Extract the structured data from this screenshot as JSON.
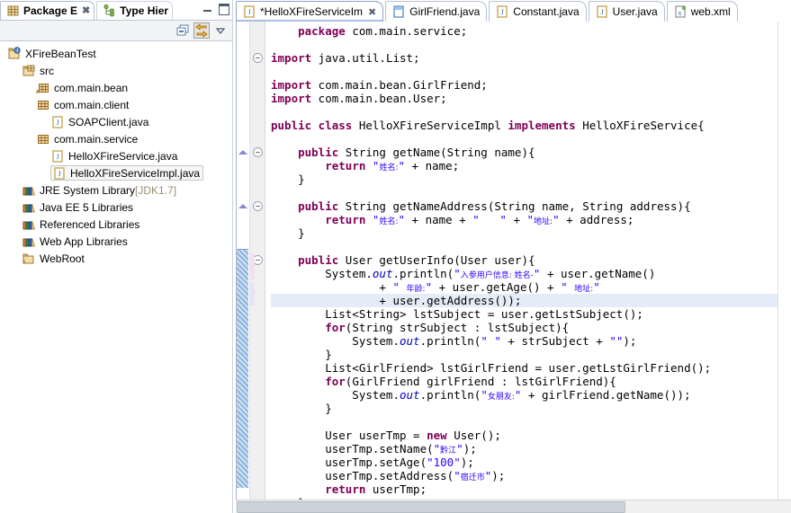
{
  "left_view": {
    "tabs": [
      {
        "label": "Package E",
        "icon": "package-explorer-icon",
        "active": true,
        "closable": true
      },
      {
        "label": "Type Hier",
        "icon": "type-hierarchy-icon",
        "active": false,
        "closable": false
      }
    ],
    "window_controls": [
      {
        "name": "minimize-button",
        "label": "–"
      },
      {
        "name": "maximize-button",
        "label": "□"
      }
    ],
    "toolbar": [
      {
        "name": "collapse-all-button",
        "label": "Collapse All",
        "icon": "collapse-all-icon",
        "pressed": false
      },
      {
        "name": "link-with-editor-button",
        "label": "Link with Editor",
        "icon": "link-editor-icon",
        "pressed": true
      },
      {
        "name": "view-menu-button",
        "label": "View Menu",
        "icon": "chevron-down-icon",
        "pressed": false
      }
    ],
    "tree": [
      {
        "label": "XFireBeanTest",
        "indent": 0,
        "icon": "java-project-icon",
        "selected": false,
        "suffix": ""
      },
      {
        "label": "src",
        "indent": 1,
        "icon": "source-folder-icon",
        "selected": false,
        "suffix": ""
      },
      {
        "label": "com.main.bean",
        "indent": 2,
        "icon": "package-warning-icon",
        "selected": false,
        "suffix": ""
      },
      {
        "label": "com.main.client",
        "indent": 2,
        "icon": "package-icon",
        "selected": false,
        "suffix": ""
      },
      {
        "label": "SOAPClient.java",
        "indent": 3,
        "icon": "java-file-icon",
        "selected": false,
        "suffix": ""
      },
      {
        "label": "com.main.service",
        "indent": 2,
        "icon": "package-icon",
        "selected": false,
        "suffix": ""
      },
      {
        "label": "HelloXFireService.java",
        "indent": 3,
        "icon": "java-file-icon",
        "selected": false,
        "suffix": ""
      },
      {
        "label": "HelloXFireServiceImpl.java",
        "indent": 3,
        "icon": "java-file-icon",
        "selected": true,
        "suffix": ""
      },
      {
        "label": "JRE System Library",
        "indent": 1,
        "icon": "library-icon",
        "selected": false,
        "suffix": " [JDK1.7]"
      },
      {
        "label": "Java EE 5 Libraries",
        "indent": 1,
        "icon": "library-icon",
        "selected": false,
        "suffix": ""
      },
      {
        "label": "Referenced Libraries",
        "indent": 1,
        "icon": "library-icon",
        "selected": false,
        "suffix": ""
      },
      {
        "label": "Web App Libraries",
        "indent": 1,
        "icon": "library-icon",
        "selected": false,
        "suffix": ""
      },
      {
        "label": "WebRoot",
        "indent": 1,
        "icon": "folder-icon",
        "selected": false,
        "suffix": ""
      }
    ]
  },
  "editor": {
    "tabs": [
      {
        "label": "*HelloXFireServiceIm",
        "icon": "java-file-icon",
        "active": true,
        "closable": true,
        "dirty": true
      },
      {
        "label": "GirlFriend.java",
        "icon": "java-class-icon",
        "active": false,
        "closable": false,
        "dirty": false
      },
      {
        "label": "Constant.java",
        "icon": "java-file-icon",
        "active": false,
        "closable": false,
        "dirty": false
      },
      {
        "label": "User.java",
        "icon": "java-file-icon",
        "active": false,
        "closable": false,
        "dirty": false
      },
      {
        "label": "web.xml",
        "icon": "xml-file-icon",
        "active": false,
        "closable": false,
        "dirty": false
      }
    ],
    "colors": {
      "keyword": "#7f0055",
      "string": "#2a00ff",
      "field": "#0000c0",
      "plain": "#000000",
      "highlight_line": "#e4ecf7",
      "active_tab_bar": "#a8c0de"
    },
    "code_lines": [
      {
        "highlight": false,
        "fold": false,
        "annot": false,
        "tokens": [
          {
            "t": "    ",
            "c": "pln"
          },
          {
            "t": "package",
            "c": "kw"
          },
          {
            "t": " com.main.service;",
            "c": "pln"
          }
        ]
      },
      {
        "highlight": false,
        "fold": false,
        "annot": false,
        "tokens": []
      },
      {
        "highlight": false,
        "fold": true,
        "annot": false,
        "tokens": [
          {
            "t": "",
            "c": "pln"
          },
          {
            "t": "import",
            "c": "kw"
          },
          {
            "t": " java.util.List;",
            "c": "pln"
          }
        ]
      },
      {
        "highlight": false,
        "fold": false,
        "annot": false,
        "tokens": []
      },
      {
        "highlight": false,
        "fold": false,
        "annot": false,
        "tokens": [
          {
            "t": "",
            "c": "pln"
          },
          {
            "t": "import",
            "c": "kw"
          },
          {
            "t": " com.main.bean.GirlFriend;",
            "c": "pln"
          }
        ]
      },
      {
        "highlight": false,
        "fold": false,
        "annot": false,
        "tokens": [
          {
            "t": "",
            "c": "pln"
          },
          {
            "t": "import",
            "c": "kw"
          },
          {
            "t": " com.main.bean.User;",
            "c": "pln"
          }
        ]
      },
      {
        "highlight": false,
        "fold": false,
        "annot": false,
        "tokens": []
      },
      {
        "highlight": false,
        "fold": false,
        "annot": false,
        "tokens": [
          {
            "t": "",
            "c": "pln"
          },
          {
            "t": "public class",
            "c": "kw"
          },
          {
            "t": " HelloXFireServiceImpl ",
            "c": "pln"
          },
          {
            "t": "implements",
            "c": "kw"
          },
          {
            "t": " HelloXFireService{",
            "c": "pln"
          }
        ]
      },
      {
        "highlight": false,
        "fold": false,
        "annot": false,
        "tokens": []
      },
      {
        "highlight": false,
        "fold": true,
        "annot": true,
        "tokens": [
          {
            "t": "    ",
            "c": "pln"
          },
          {
            "t": "public",
            "c": "kw"
          },
          {
            "t": " String getName(String name){",
            "c": "pln"
          }
        ]
      },
      {
        "highlight": false,
        "fold": false,
        "annot": false,
        "tokens": [
          {
            "t": "        ",
            "c": "pln"
          },
          {
            "t": "return",
            "c": "kw"
          },
          {
            "t": " ",
            "c": "pln"
          },
          {
            "t": "\"",
            "c": "str"
          },
          {
            "t": "姓名:",
            "c": "str cjk"
          },
          {
            "t": "\"",
            "c": "str"
          },
          {
            "t": " + name;",
            "c": "pln"
          }
        ]
      },
      {
        "highlight": false,
        "fold": false,
        "annot": false,
        "tokens": [
          {
            "t": "    }",
            "c": "pln"
          }
        ]
      },
      {
        "highlight": false,
        "fold": false,
        "annot": false,
        "tokens": []
      },
      {
        "highlight": false,
        "fold": true,
        "annot": true,
        "tokens": [
          {
            "t": "    ",
            "c": "pln"
          },
          {
            "t": "public",
            "c": "kw"
          },
          {
            "t": " String getNameAddress(String name, String address){",
            "c": "pln"
          }
        ]
      },
      {
        "highlight": false,
        "fold": false,
        "annot": false,
        "tokens": [
          {
            "t": "        ",
            "c": "pln"
          },
          {
            "t": "return",
            "c": "kw"
          },
          {
            "t": " ",
            "c": "pln"
          },
          {
            "t": "\"",
            "c": "str"
          },
          {
            "t": "姓名:",
            "c": "str cjk"
          },
          {
            "t": "\"",
            "c": "str"
          },
          {
            "t": " + name + ",
            "c": "pln"
          },
          {
            "t": "\"   \"",
            "c": "str"
          },
          {
            "t": " + ",
            "c": "pln"
          },
          {
            "t": "\"",
            "c": "str"
          },
          {
            "t": "地址:",
            "c": "str cjk"
          },
          {
            "t": "\"",
            "c": "str"
          },
          {
            "t": " + address;",
            "c": "pln"
          }
        ]
      },
      {
        "highlight": false,
        "fold": false,
        "annot": false,
        "tokens": [
          {
            "t": "    }",
            "c": "pln"
          }
        ]
      },
      {
        "highlight": false,
        "fold": false,
        "annot": false,
        "tokens": []
      },
      {
        "highlight": false,
        "fold": true,
        "annot": true,
        "tokens": [
          {
            "t": "    ",
            "c": "pln"
          },
          {
            "t": "public",
            "c": "kw"
          },
          {
            "t": " User getUserInfo(User user){",
            "c": "pln"
          }
        ]
      },
      {
        "highlight": false,
        "fold": false,
        "annot": false,
        "tokens": [
          {
            "t": "        System.",
            "c": "pln"
          },
          {
            "t": "out",
            "c": "fld"
          },
          {
            "t": ".println(",
            "c": "pln"
          },
          {
            "t": "\"",
            "c": "str"
          },
          {
            "t": "入参用户信息: 姓名-",
            "c": "str cjk"
          },
          {
            "t": "\"",
            "c": "str"
          },
          {
            "t": " + user.getName()",
            "c": "pln"
          }
        ]
      },
      {
        "highlight": false,
        "fold": false,
        "annot": false,
        "tokens": [
          {
            "t": "                + ",
            "c": "pln"
          },
          {
            "t": "\" ",
            "c": "str"
          },
          {
            "t": "年龄:",
            "c": "str cjk"
          },
          {
            "t": "\"",
            "c": "str"
          },
          {
            "t": " + user.getAge() + ",
            "c": "pln"
          },
          {
            "t": "\" ",
            "c": "str"
          },
          {
            "t": "地址:",
            "c": "str cjk"
          },
          {
            "t": "\"",
            "c": "str"
          }
        ]
      },
      {
        "highlight": true,
        "fold": false,
        "annot": false,
        "tokens": [
          {
            "t": "                + user.getAddress());",
            "c": "pln"
          }
        ]
      },
      {
        "highlight": false,
        "fold": false,
        "annot": false,
        "tokens": [
          {
            "t": "        List<String> lstSubject = user.getLstSubject();",
            "c": "pln"
          }
        ]
      },
      {
        "highlight": false,
        "fold": false,
        "annot": false,
        "tokens": [
          {
            "t": "        ",
            "c": "pln"
          },
          {
            "t": "for",
            "c": "kw"
          },
          {
            "t": "(String strSubject : lstSubject){",
            "c": "pln"
          }
        ]
      },
      {
        "highlight": false,
        "fold": false,
        "annot": false,
        "tokens": [
          {
            "t": "            System.",
            "c": "pln"
          },
          {
            "t": "out",
            "c": "fld"
          },
          {
            "t": ".println(",
            "c": "pln"
          },
          {
            "t": "\" \"",
            "c": "str"
          },
          {
            "t": " + strSubject + ",
            "c": "pln"
          },
          {
            "t": "\"\"",
            "c": "str"
          },
          {
            "t": ");",
            "c": "pln"
          }
        ]
      },
      {
        "highlight": false,
        "fold": false,
        "annot": false,
        "tokens": [
          {
            "t": "        }",
            "c": "pln"
          }
        ]
      },
      {
        "highlight": false,
        "fold": false,
        "annot": false,
        "tokens": [
          {
            "t": "        List<GirlFriend> lstGirlFriend = user.getLstGirlFriend();",
            "c": "pln"
          }
        ]
      },
      {
        "highlight": false,
        "fold": false,
        "annot": false,
        "tokens": [
          {
            "t": "        ",
            "c": "pln"
          },
          {
            "t": "for",
            "c": "kw"
          },
          {
            "t": "(GirlFriend girlFriend : lstGirlFriend){",
            "c": "pln"
          }
        ]
      },
      {
        "highlight": false,
        "fold": false,
        "annot": false,
        "tokens": [
          {
            "t": "            System.",
            "c": "pln"
          },
          {
            "t": "out",
            "c": "fld"
          },
          {
            "t": ".println(",
            "c": "pln"
          },
          {
            "t": "\"",
            "c": "str"
          },
          {
            "t": "女朋友:",
            "c": "str cjk"
          },
          {
            "t": "\"",
            "c": "str"
          },
          {
            "t": " + girlFriend.getName());",
            "c": "pln"
          }
        ]
      },
      {
        "highlight": false,
        "fold": false,
        "annot": false,
        "tokens": [
          {
            "t": "        }",
            "c": "pln"
          }
        ]
      },
      {
        "highlight": false,
        "fold": false,
        "annot": false,
        "tokens": []
      },
      {
        "highlight": false,
        "fold": false,
        "annot": false,
        "tokens": [
          {
            "t": "        User userTmp = ",
            "c": "pln"
          },
          {
            "t": "new",
            "c": "kw"
          },
          {
            "t": " User();",
            "c": "pln"
          }
        ]
      },
      {
        "highlight": false,
        "fold": false,
        "annot": false,
        "tokens": [
          {
            "t": "        userTmp.setName(",
            "c": "pln"
          },
          {
            "t": "\"",
            "c": "str"
          },
          {
            "t": "黔江",
            "c": "str cjk"
          },
          {
            "t": "\"",
            "c": "str"
          },
          {
            "t": ");",
            "c": "pln"
          }
        ]
      },
      {
        "highlight": false,
        "fold": false,
        "annot": false,
        "tokens": [
          {
            "t": "        userTmp.setAge(",
            "c": "pln"
          },
          {
            "t": "\"100\"",
            "c": "str"
          },
          {
            "t": ");",
            "c": "pln"
          }
        ]
      },
      {
        "highlight": false,
        "fold": false,
        "annot": false,
        "tokens": [
          {
            "t": "        userTmp.setAddress(",
            "c": "pln"
          },
          {
            "t": "\"",
            "c": "str"
          },
          {
            "t": "宿迁市",
            "c": "str cjk"
          },
          {
            "t": "\"",
            "c": "str"
          },
          {
            "t": ");",
            "c": "pln"
          }
        ]
      },
      {
        "highlight": false,
        "fold": false,
        "annot": false,
        "tokens": [
          {
            "t": "        ",
            "c": "pln"
          },
          {
            "t": "return",
            "c": "kw"
          },
          {
            "t": " userTmp;",
            "c": "pln"
          }
        ]
      },
      {
        "highlight": false,
        "fold": false,
        "annot": false,
        "tokens": [
          {
            "t": "    }",
            "c": "pln"
          }
        ]
      }
    ]
  }
}
